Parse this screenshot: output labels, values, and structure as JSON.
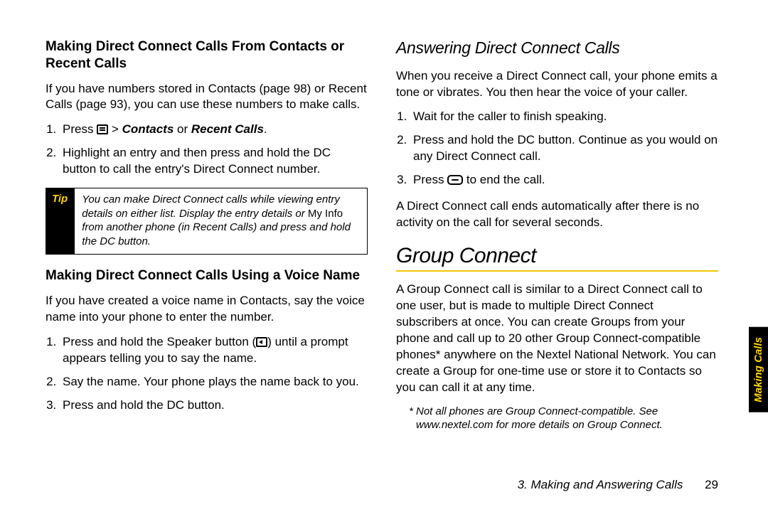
{
  "left": {
    "h3a": "Making Direct Connect Calls From Contacts or Recent Calls",
    "p1": "If you have numbers stored in Contacts (page 98) or Recent Calls (page 93), you can use these numbers to make calls.",
    "ol1": {
      "s1a": "Press ",
      "s1b": " > ",
      "s1c": "Contacts",
      "s1d": " or ",
      "s1e": "Recent Calls",
      "s1f": ".",
      "s2": "Highlight an entry and then press and hold the DC button to call the entry's Direct Connect number."
    },
    "tip": {
      "label": "Tip",
      "t1": "You can make Direct Connect calls while viewing entry details on either list. Display the entry details or ",
      "t2": "My Info",
      "t3": " from another phone (in Recent Calls) and press and hold the DC button."
    },
    "h3b": "Making Direct Connect Calls Using a Voice Name",
    "p2": "If you have created a voice name in Contacts, say the voice name into your phone to enter the number.",
    "ol2": {
      "s1a": "Press and hold the Speaker button (",
      "s1b": ") until a prompt appears telling you to say the name.",
      "s2": "Say the name. Your phone plays the name back to you.",
      "s3": "Press and hold the DC button."
    }
  },
  "right": {
    "h2": "Answering Direct Connect Calls",
    "p1": "When you receive a Direct Connect call, your phone emits a tone or vibrates. You then hear the voice of your caller.",
    "ol1": {
      "s1": "Wait for the caller to finish speaking.",
      "s2": "Press and hold the DC button. Continue as you would on any Direct Connect call.",
      "s3a": "Press ",
      "s3b": " to end the call."
    },
    "p2": "A Direct Connect call ends automatically after there is no activity on the call for several seconds.",
    "h1": "Group Connect",
    "p3": "A Group Connect call is similar to a Direct Connect call to one user, but is made to multiple Direct Connect subscribers at once. You can create Groups from your phone and call up to 20 other Group Connect-compatible phones* anywhere on the Nextel National Network. You can create a Group for one-time use or store it to Contacts so you can call it at any time.",
    "fn": "* Not all phones are Group Connect-compatible. See www.nextel.com for more details on Group Connect."
  },
  "footer": {
    "chapter": "3. Making and Answering Calls",
    "page": "29"
  },
  "sidetab": "Making Calls"
}
